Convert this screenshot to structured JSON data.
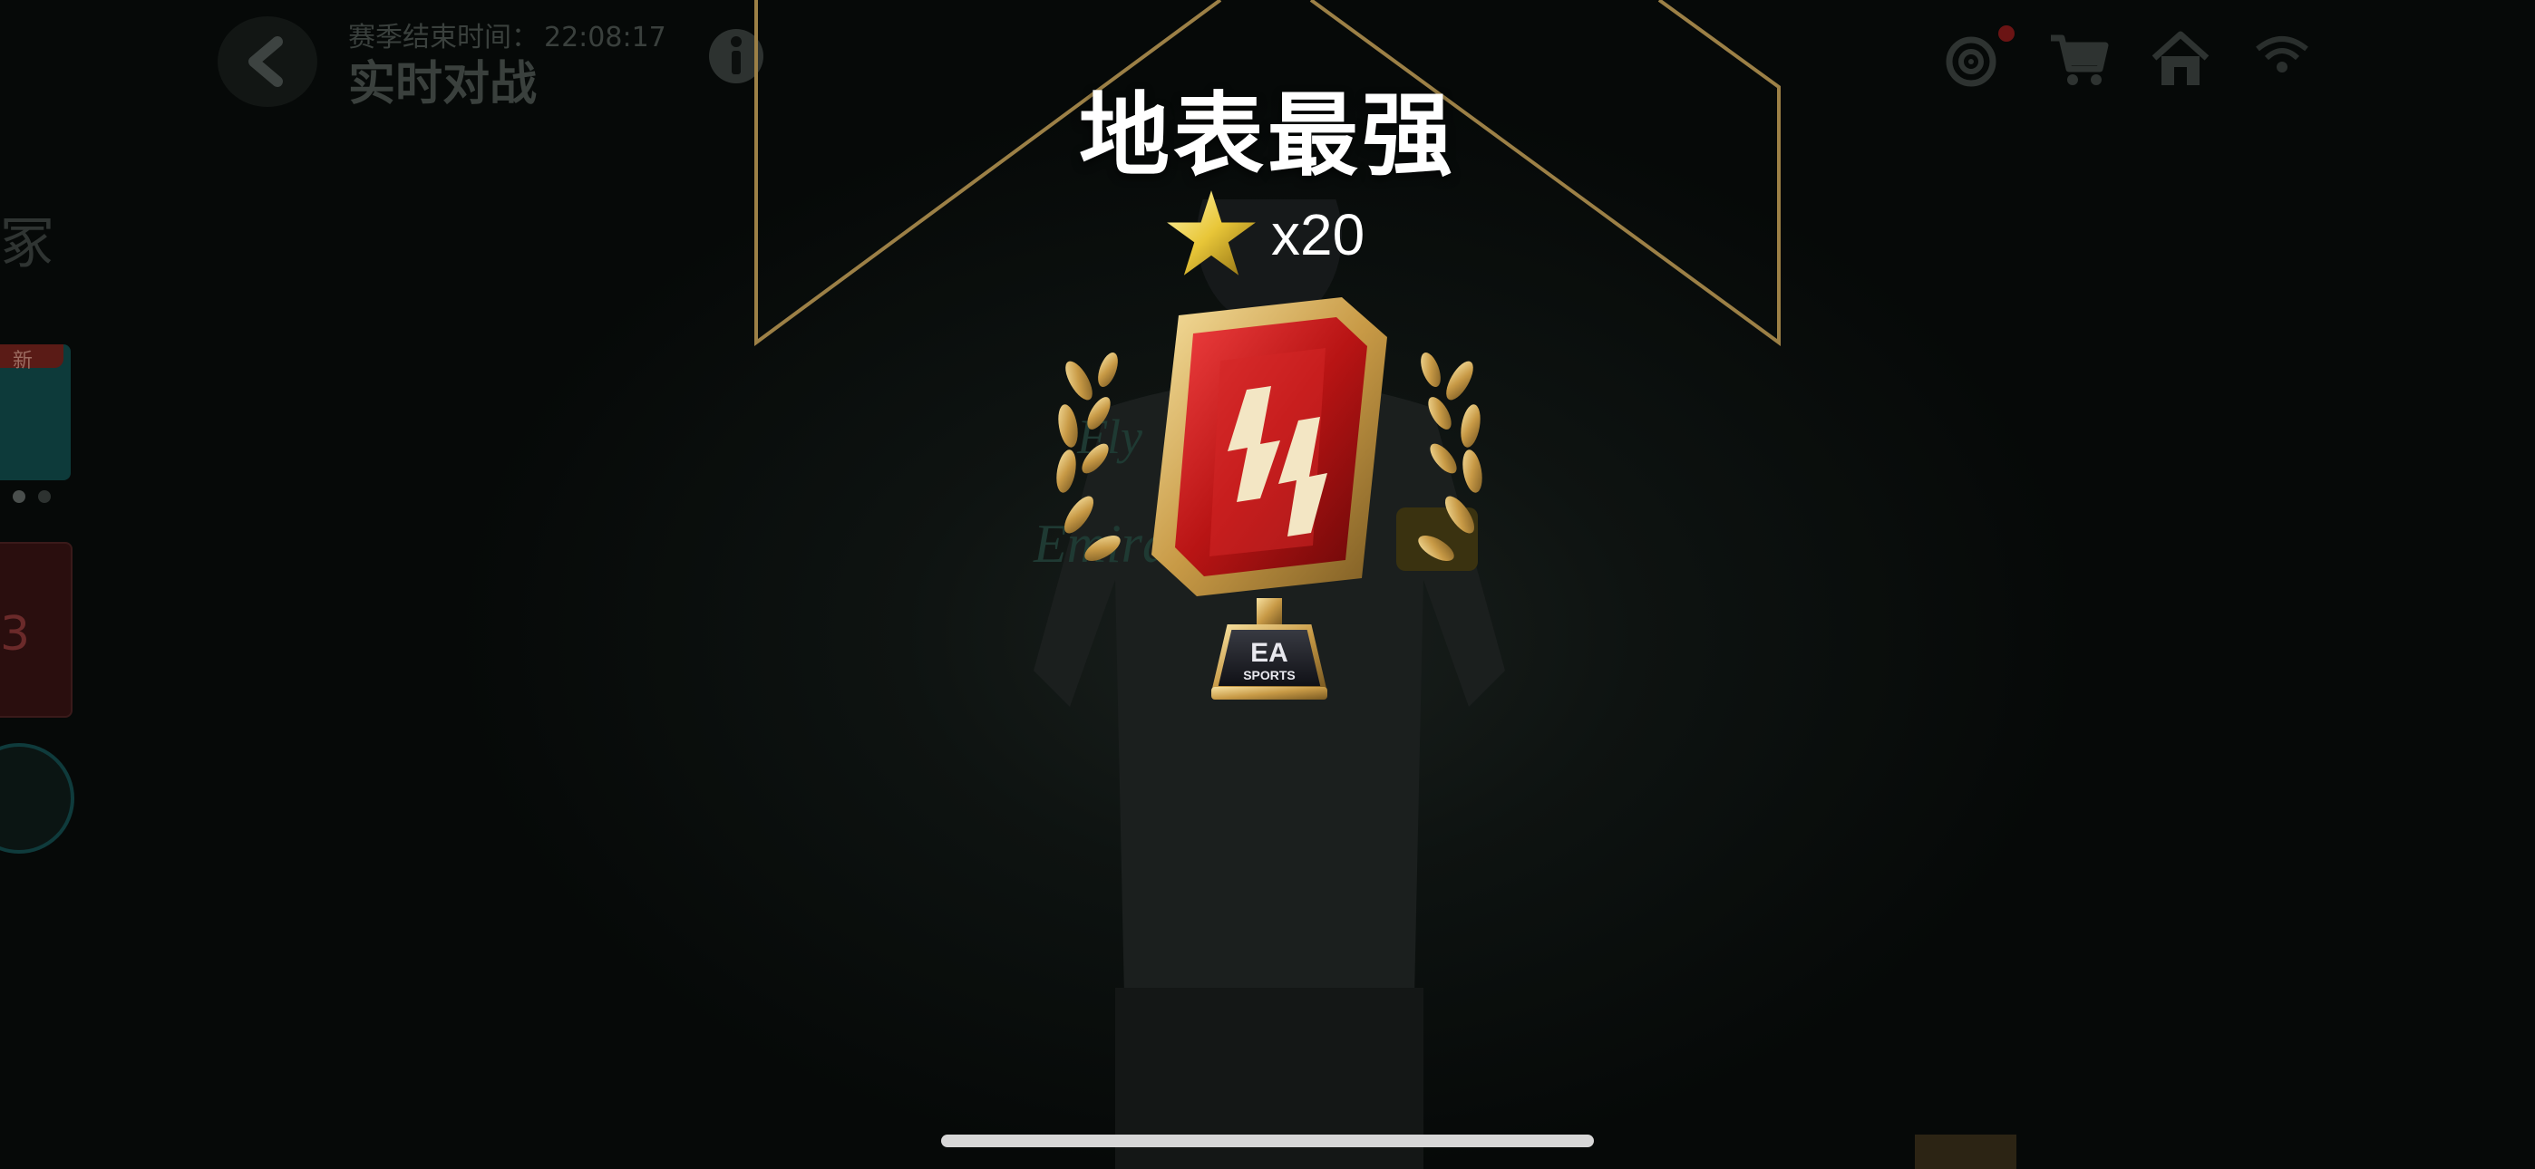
{
  "header": {
    "back_icon": "chevron-left-icon",
    "season_label": "赛季结束时间：",
    "season_time": "22:08:17",
    "title": "实时对战",
    "info_icon": "info-icon"
  },
  "top_right_icons": [
    "target-icon",
    "cart-icon",
    "home-icon",
    "wifi-icon"
  ],
  "sidebar": {
    "glyph": "冢",
    "badge": "新",
    "card_number": "3"
  },
  "reward": {
    "title": "地表最强",
    "star_icon": "gold-star-icon",
    "star_count": "x20",
    "trophy_icon": "trophy-icon",
    "trophy_brand": "EA",
    "trophy_brand_sub": "SPORTS"
  },
  "colors": {
    "accent_gold": "#b08f4a",
    "trophy_red": "#c81e1e",
    "background": "#070b09"
  }
}
